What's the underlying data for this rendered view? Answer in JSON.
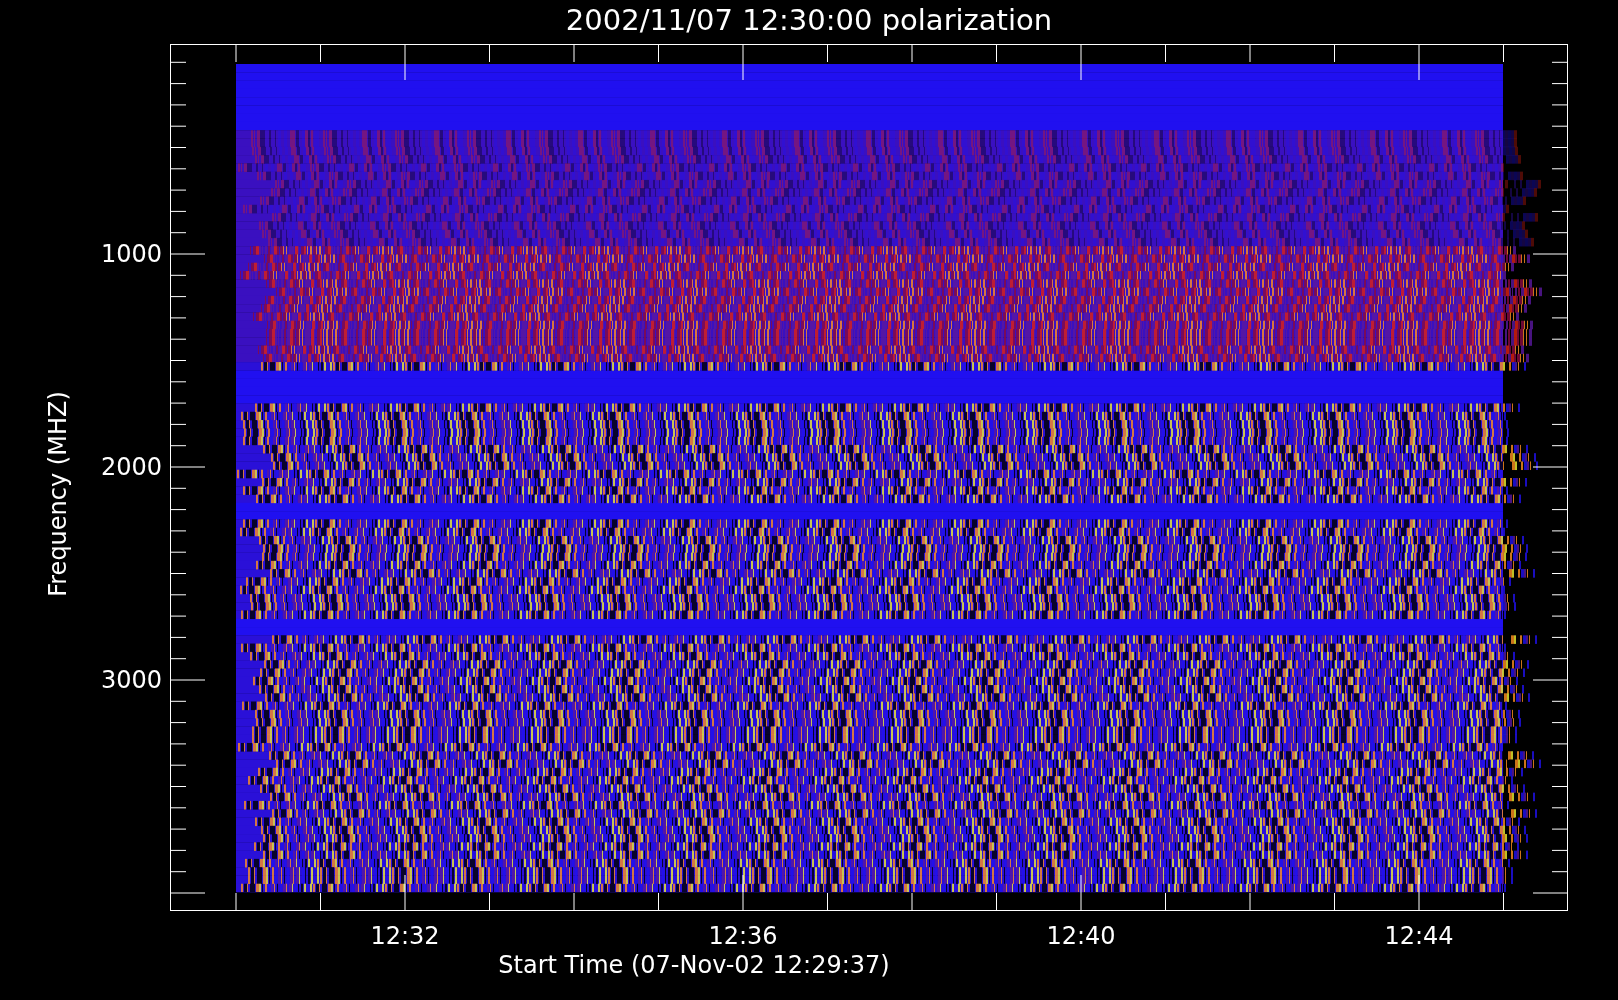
{
  "title": "2002/11/07 12:30:00 polarization",
  "ylabel": "Frequency (MHZ)",
  "xlabel": "Start Time (07-Nov-02 12:29:37)",
  "yticks": [
    "1000",
    "2000",
    "3000"
  ],
  "xticks": [
    "12:32",
    "12:36",
    "12:40",
    "12:44"
  ]
}
